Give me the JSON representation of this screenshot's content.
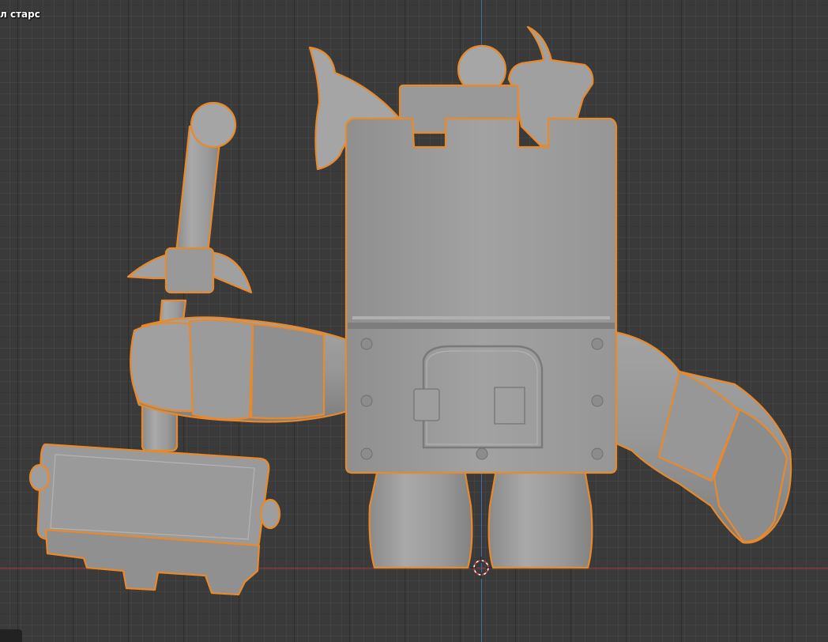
{
  "viewport": {
    "object_name": "л старс"
  },
  "colors": {
    "background": "#3a3a3a",
    "mesh": "#9c9c9c",
    "selection_outline": "#e8892b",
    "x_axis": "#a8343b",
    "y_axis": "#3d6aa8"
  },
  "icons": {
    "origin": "3d-cursor-icon"
  }
}
